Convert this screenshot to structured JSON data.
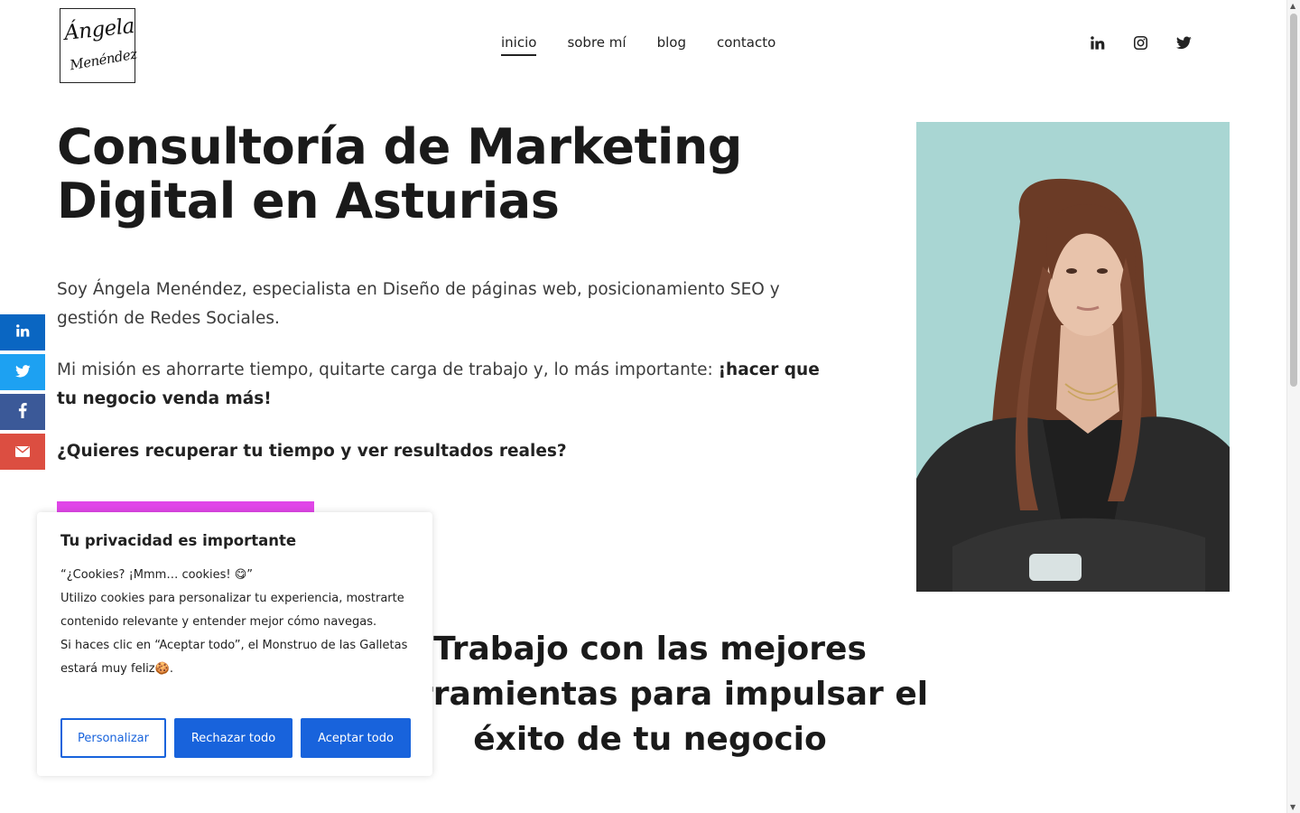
{
  "header": {
    "logo_line1": "Ángela",
    "logo_line2": "Menéndez",
    "nav": [
      {
        "label": "inicio",
        "active": true
      },
      {
        "label": "sobre mí",
        "active": false
      },
      {
        "label": "blog",
        "active": false
      },
      {
        "label": "contacto",
        "active": false
      }
    ],
    "social_icons": [
      "linkedin-icon",
      "instagram-icon",
      "twitter-icon"
    ]
  },
  "hero": {
    "title_line1": "Consultoría de Marketing",
    "title_line2": "Digital en Asturias",
    "paragraph1": "Soy Ángela Menéndez, especialista en Diseño de páginas web, posicionamiento SEO y gestión de Redes Sociales.",
    "paragraph2_text": "Mi misión es ahorrarte tiempo, quitarte carga de trabajo y, lo más importante: ",
    "paragraph2_bold": "¡hacer que tu negocio venda más!",
    "question": "¿Quieres recuperar tu tiempo y ver resultados reales?",
    "cta_color": "#e046e8"
  },
  "section2": {
    "line1": "Trabajo con las mejores",
    "line2": "herramientas para impulsar el",
    "line3": "éxito de tu negocio"
  },
  "share_bar": [
    {
      "icon": "linkedin-icon",
      "color": "#0a66c2"
    },
    {
      "icon": "twitter-icon",
      "color": "#1da1f2"
    },
    {
      "icon": "facebook-icon",
      "color": "#3b5998"
    },
    {
      "icon": "mail-icon",
      "color": "#dc4e41"
    }
  ],
  "cookie": {
    "title": "Tu privacidad es importante",
    "line1": "“¿Cookies? ¡Mmm… cookies! 😋”",
    "line2": "Utilizo cookies para personalizar tu experiencia, mostrarte contenido relevante y entender mejor cómo navegas.",
    "line3": "Si haces clic en “Aceptar todo”, el Monstruo de las Galletas estará muy feliz🍪.",
    "btn_customize": "Personalizar",
    "btn_reject": "Rechazar todo",
    "btn_accept": "Aceptar todo",
    "accent_color": "#1863dc"
  }
}
